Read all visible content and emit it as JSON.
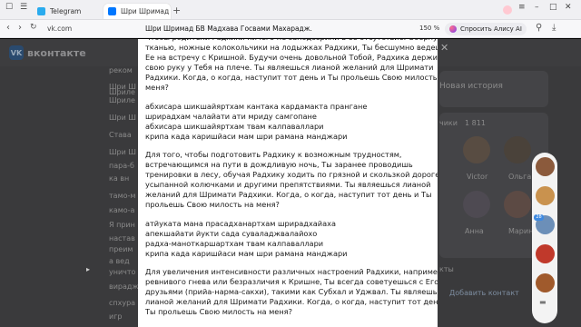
{
  "browser": {
    "tabs": [
      {
        "label": "Telegram",
        "icon": "telegram-icon",
        "color": "#2aabee"
      },
      {
        "label": "Шри Шримад БВ Мадх",
        "icon": "vk-icon",
        "color": "#0077ff"
      }
    ],
    "new_tab": "+",
    "url_host": "vk.com",
    "page_title": "Шри Шримад БВ Мадхава Госвами Махарадж.",
    "zoom": "150 %",
    "ask_label": "Спросить Алису AI"
  },
  "vk": {
    "logo_text": "VK",
    "brand": "вконтакте",
    "left_fragments": [
      "реком",
      "Шри Ш",
      "Шриле",
      "Шриле",
      "Шри Ш",
      "Става",
      "Шри Ш",
      "пара-б",
      "ка вн",
      "тамо-м",
      "камо-а",
      "Я прин",
      "настав",
      "преим",
      "а вед",
      "уничто",
      "вирадж",
      "спхура",
      "игр"
    ],
    "right_fragments": {
      "history": "Новая история",
      "friends": "чики",
      "friends_count": "1 811",
      "names": [
        "Victor",
        "Ольга",
        "Анна",
        "Марина"
      ],
      "contacts": "кты",
      "add_contact": "Добавить контакт"
    }
  },
  "post": {
    "paragraphs": [
      {
        "type": "prose",
        "lines": [
          "Чтобы родители Радхики ничего не заподозрили в её отсутствие. Обернув",
          "тканью, ножные колокольчики на лодыжках Радхики, Ты бесшумно ведешь",
          "Ее на встречу с Кришной. Будучи очень довольной Тобой, Радхика держит",
          "свою руку у Тебя на плече. Ты являешься лианой желаний для Шримати",
          "Радхики. Когда, о когда, наступит тот день и Ты прольешь Свою милость на",
          "меня?"
        ]
      },
      {
        "type": "verse",
        "lines": [
          "абхисара шикшайяртхам кантака кардамакта прангане",
          "шрирадхам чалайати ати мриду самгопане",
          "абхисара шикшайяртхам твам калпаваллари",
          "крипа када каришйаси мам шри рамана манджари"
        ]
      },
      {
        "type": "prose",
        "lines": [
          "Для того, чтобы подготовить Радхику к возможным трудностям,",
          "встречающимся на пути в дождливую ночь, Ты заранее проводишь",
          "тренировки в лесу, обучая Радхику ходить по грязной и скользкой дороге",
          "усыпанной колючками и другими препятствиями. Ты являешься лианой",
          "желаний для Шримати Радхики. Когда, о когда, наступит тот день и Ты",
          "прольешь Свою милость на меня?"
        ]
      },
      {
        "type": "verse",
        "lines": [
          "атйуката мана прасадханартхам шрирадхайаха",
          "апекшайати йукти сада суваладжвалайохо",
          "радха-маноткаршартхам твам калпаваллари",
          "крипа када каришйаси мам шри рамана манджари"
        ]
      },
      {
        "type": "prose",
        "lines": [
          "Для увеличения интенсивности различных настроений Радхики, например",
          "ревнивого гнева или безразличия к Кришне, Ты всегда советуешься с Его",
          "друзьями (прийа-нарма-сакхи), такими как Субхал и Уджвал. Ты являешься",
          "лианой желаний для Шримати Радхики. Когда, о когда, наступит тот день и",
          "Ты прольешь Свою милость на меня?"
        ]
      }
    ]
  },
  "sidebar_avatars": [
    {
      "badge": ""
    },
    {
      "badge": ""
    },
    {
      "badge": "28"
    },
    {
      "badge": ""
    },
    {
      "badge": ""
    }
  ],
  "icons": {
    "tab_close": "×",
    "cursor": "▸",
    "chat": "▬"
  }
}
